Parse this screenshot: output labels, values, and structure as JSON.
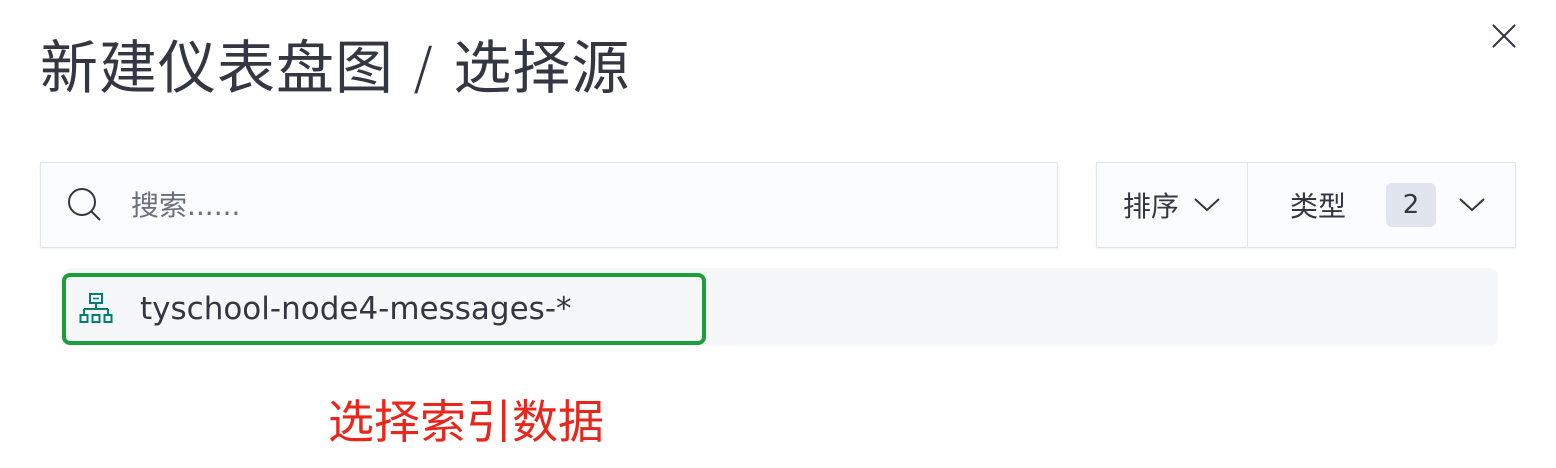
{
  "dialog": {
    "title": "新建仪表盘图 / 选择源",
    "close_icon": "close-icon"
  },
  "search": {
    "placeholder": "搜索......",
    "value": "",
    "icon": "search-icon"
  },
  "filters": {
    "sort_label": "排序",
    "type_label": "类型",
    "type_count": "2",
    "chevron_icon": "chevron-down-icon"
  },
  "results": [
    {
      "label": "tyschool-node4-messages-*",
      "icon": "index-pattern-icon"
    }
  ],
  "annotation": {
    "text": "选择索引数据",
    "color": "#e8261b"
  },
  "colors": {
    "highlight_border": "#1e9e3a",
    "icon_teal": "#017d73",
    "text": "#343741"
  }
}
